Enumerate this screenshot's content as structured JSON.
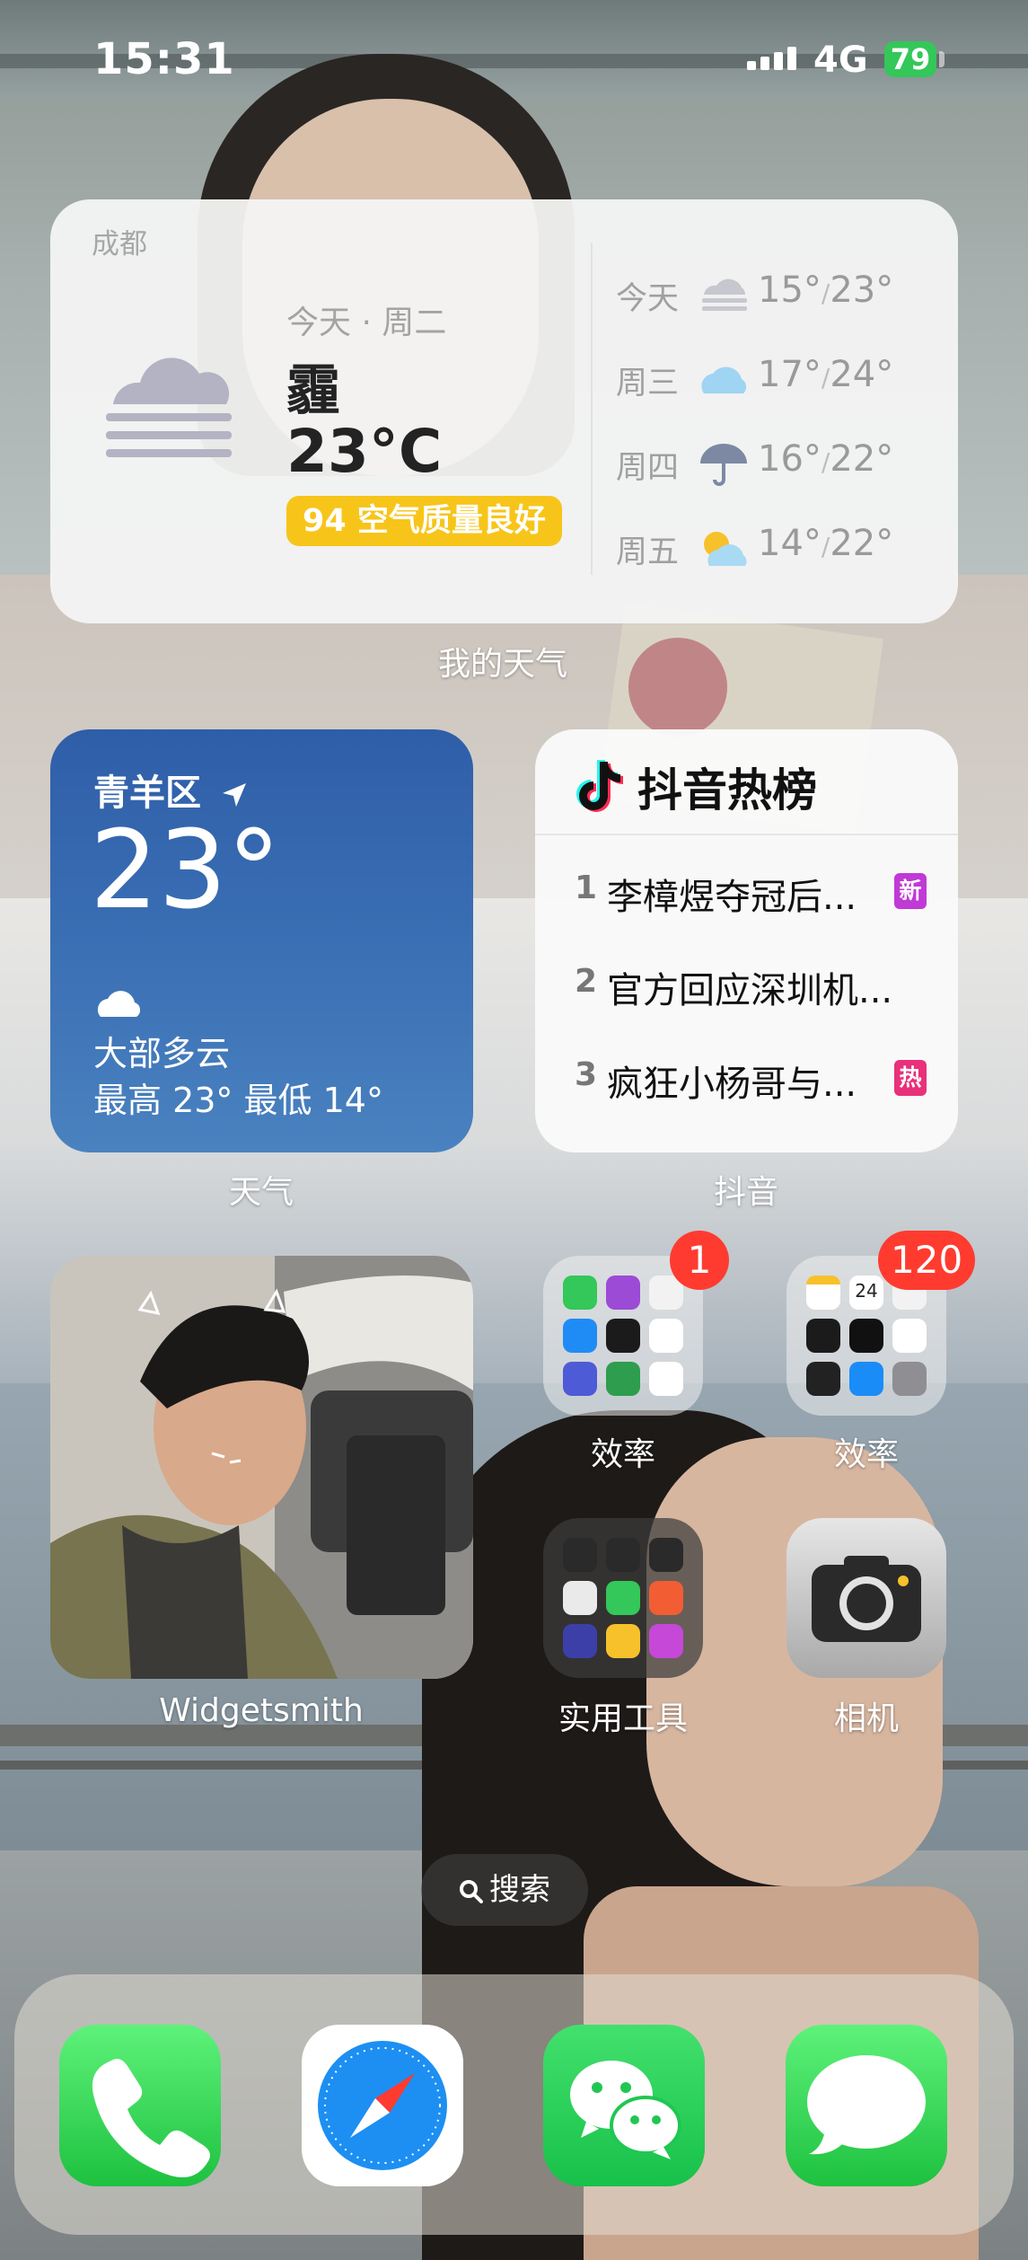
{
  "status_bar": {
    "time": "15:31",
    "network": "4G",
    "battery": "79",
    "battery_color": "#34c759"
  },
  "weather_widget_large": {
    "city": "成都",
    "date": "今天 · 周二",
    "condition": "霾",
    "temperature": "23°C",
    "aqi": "94 空气质量良好",
    "forecast": [
      {
        "day": "今天",
        "icon": "haze-icon",
        "low": "15°",
        "high": "23°"
      },
      {
        "day": "周三",
        "icon": "cloud-icon",
        "low": "17°",
        "high": "24°"
      },
      {
        "day": "周四",
        "icon": "umbrella-icon",
        "low": "16°",
        "high": "22°"
      },
      {
        "day": "周五",
        "icon": "partly-sunny-icon",
        "low": "14°",
        "high": "22°"
      }
    ],
    "label": "我的天气"
  },
  "weather_widget_small": {
    "location": "青羊区",
    "temperature": "23°",
    "condition": "大部多云",
    "range": "最高 23° 最低 14°",
    "label": "天气"
  },
  "douyin_widget": {
    "title": "抖音热榜",
    "items": [
      {
        "rank": "1",
        "text": "李樟煜夺冠后...",
        "badge": "新",
        "badge_color": "#c03ad6"
      },
      {
        "rank": "2",
        "text": "官方回应深圳机...",
        "badge": "",
        "badge_color": ""
      },
      {
        "rank": "3",
        "text": "疯狂小杨哥与...",
        "badge": "热",
        "badge_color": "#e8317a"
      }
    ],
    "label": "抖音"
  },
  "photo_widget": {
    "label": "Widgetsmith"
  },
  "apps": {
    "folder1": {
      "label": "效率",
      "badge": "1"
    },
    "folder2": {
      "label": "效率",
      "badge": "120",
      "calendar_day": "24"
    },
    "folder3": {
      "label": "实用工具"
    },
    "camera": {
      "label": "相机"
    }
  },
  "search": {
    "label": "搜索"
  },
  "dock": [
    "phone-icon",
    "safari-icon",
    "wechat-icon",
    "messages-icon"
  ]
}
